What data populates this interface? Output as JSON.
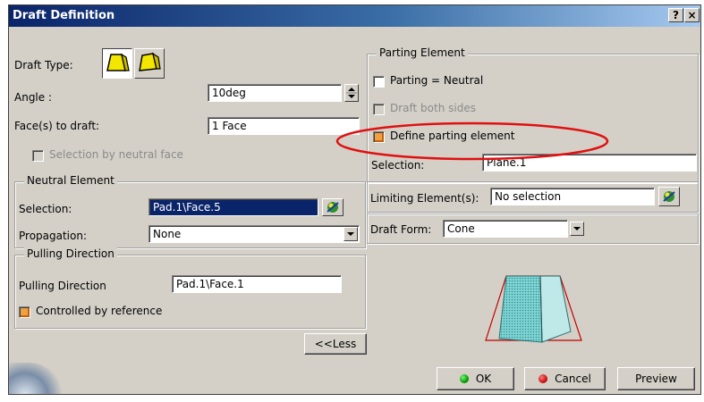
{
  "window": {
    "title": "Draft Definition",
    "help_label": "?",
    "close_label": "×"
  },
  "left": {
    "draft_type_label": "Draft Type:",
    "angle_label": "Angle :",
    "angle_value": "10deg",
    "faces_label": "Face(s) to draft:",
    "faces_value": "1 Face",
    "neutral_face_label": "Selection by neutral face",
    "neutral": {
      "legend": "Neutral Element",
      "selection_label": "Selection:",
      "selection_value": "Pad.1\\Face.5",
      "propagation_label": "Propagation:",
      "propagation_value": "None"
    },
    "pulling": {
      "legend": "Pulling Direction",
      "label": "Pulling Direction",
      "value": "Pad.1\\Face.1",
      "controlled_label": "Controlled by reference"
    },
    "less_label": "<<Less"
  },
  "right": {
    "parting": {
      "legend": "Parting Element",
      "parting_neutral_label": "Parting = Neutral",
      "draft_both_label": "Draft both sides",
      "define_label": "Define parting element",
      "selection_label": "Selection:",
      "selection_value": "Plane.1"
    },
    "limiting_label": "Limiting Element(s):",
    "limiting_value": "No selection",
    "form_label": "Draft Form:",
    "form_value": "Cone"
  },
  "buttons": {
    "ok": "OK",
    "cancel": "Cancel",
    "preview": "Preview"
  },
  "colors": {
    "title_bar": "#0a246a",
    "highlight_ellipse": "#e01010",
    "ok_dot": "#00a000",
    "cancel_dot": "#d01010"
  },
  "icons": [
    "draft-type-constant-icon",
    "draft-type-variable-icon",
    "spin-icon",
    "feature-picker-icon",
    "draft-preview-icon"
  ]
}
